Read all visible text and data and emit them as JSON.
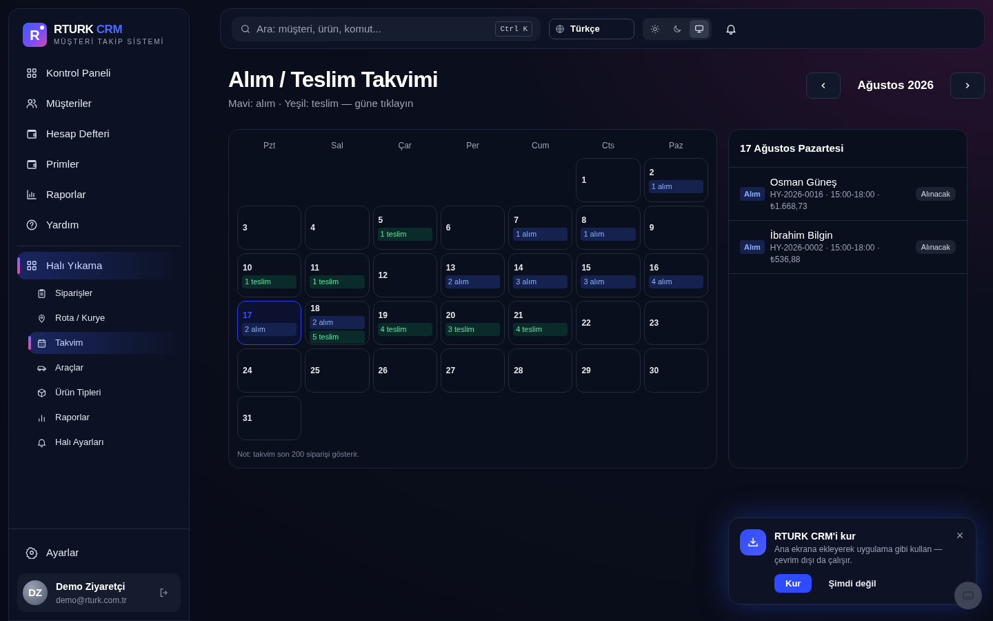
{
  "sidebar": {
    "brand": {
      "logo_letter": "R",
      "name": "RTURK",
      "name_accent": "CRM",
      "subtitle": "MÜŞTERİ TAKİP SİSTEMİ"
    },
    "items": [
      {
        "label": "Kontrol Paneli",
        "selected": false
      },
      {
        "label": "Müşteriler",
        "selected": false
      },
      {
        "label": "Hesap Defteri",
        "selected": false
      },
      {
        "label": "Primler",
        "selected": false
      },
      {
        "label": "Raporlar",
        "selected": false
      },
      {
        "label": "Yardım",
        "selected": false
      }
    ],
    "section": {
      "label": "Halı Yıkama",
      "selected": true,
      "children": [
        {
          "label": "Siparişler",
          "selected": false
        },
        {
          "label": "Rota / Kurye",
          "selected": false
        },
        {
          "label": "Takvim",
          "selected": true
        },
        {
          "label": "Araçlar",
          "selected": false
        },
        {
          "label": "Ürün Tipleri",
          "selected": false
        },
        {
          "label": "Raporlar",
          "selected": false
        },
        {
          "label": "Halı Ayarları",
          "selected": false
        }
      ]
    },
    "settings": {
      "label": "Ayarlar"
    },
    "user": {
      "initials": "DZ",
      "name": "Demo Ziyaretçi",
      "email": "demo@rturk.com.tr"
    }
  },
  "topbar": {
    "search": {
      "placeholder": "Ara: müşteri, ürün, komut...",
      "shortcut": "Ctrl K"
    },
    "language": "Türkçe",
    "themes": [
      {
        "selected": false
      },
      {
        "selected": false
      },
      {
        "selected": true
      }
    ]
  },
  "page": {
    "title": "Alım / Teslim Takvimi",
    "subtitle": "Mavi: alım · Yeşil: teslim — güne tıklayın",
    "month": "Ağustos 2026"
  },
  "calendar": {
    "weekdays": [
      "Pzt",
      "Sal",
      "Çar",
      "Per",
      "Cum",
      "Cts",
      "Paz"
    ],
    "cells": [
      {
        "kind": "blank"
      },
      {
        "kind": "blank"
      },
      {
        "kind": "blank"
      },
      {
        "kind": "blank"
      },
      {
        "kind": "blank"
      },
      {
        "kind": "day",
        "day": "1",
        "selected": false
      },
      {
        "kind": "day",
        "day": "2",
        "selected": false,
        "events": [
          {
            "kind": "pickup",
            "label": "1 alım"
          }
        ]
      },
      {
        "kind": "day",
        "day": "3",
        "selected": false
      },
      {
        "kind": "day",
        "day": "4",
        "selected": false
      },
      {
        "kind": "day",
        "day": "5",
        "selected": false,
        "events": [
          {
            "kind": "delivery",
            "label": "1 teslim"
          }
        ]
      },
      {
        "kind": "day",
        "day": "6",
        "selected": false
      },
      {
        "kind": "day",
        "day": "7",
        "selected": false,
        "events": [
          {
            "kind": "pickup",
            "label": "1 alım"
          }
        ]
      },
      {
        "kind": "day",
        "day": "8",
        "selected": false,
        "events": [
          {
            "kind": "pickup",
            "label": "1 alım"
          }
        ]
      },
      {
        "kind": "day",
        "day": "9",
        "selected": false
      },
      {
        "kind": "day",
        "day": "10",
        "selected": false,
        "events": [
          {
            "kind": "delivery",
            "label": "1 teslim"
          }
        ]
      },
      {
        "kind": "day",
        "day": "11",
        "selected": false,
        "events": [
          {
            "kind": "delivery",
            "label": "1 teslim"
          }
        ]
      },
      {
        "kind": "day",
        "day": "12",
        "selected": false
      },
      {
        "kind": "day",
        "day": "13",
        "selected": false,
        "events": [
          {
            "kind": "pickup",
            "label": "2 alım"
          }
        ]
      },
      {
        "kind": "day",
        "day": "14",
        "selected": false,
        "events": [
          {
            "kind": "pickup",
            "label": "3 alım"
          }
        ]
      },
      {
        "kind": "day",
        "day": "15",
        "selected": false,
        "events": [
          {
            "kind": "pickup",
            "label": "3 alım"
          }
        ]
      },
      {
        "kind": "day",
        "day": "16",
        "selected": false,
        "events": [
          {
            "kind": "pickup",
            "label": "4 alım"
          }
        ]
      },
      {
        "kind": "day",
        "day": "17",
        "selected": true,
        "events": [
          {
            "kind": "pickup",
            "label": "2 alım"
          }
        ]
      },
      {
        "kind": "day",
        "day": "18",
        "selected": false,
        "events": [
          {
            "kind": "pickup",
            "label": "2 alım"
          },
          {
            "kind": "delivery",
            "label": "5 teslim"
          }
        ]
      },
      {
        "kind": "day",
        "day": "19",
        "selected": false,
        "events": [
          {
            "kind": "delivery",
            "label": "4 teslim"
          }
        ]
      },
      {
        "kind": "day",
        "day": "20",
        "selected": false,
        "events": [
          {
            "kind": "delivery",
            "label": "3 teslim"
          }
        ]
      },
      {
        "kind": "day",
        "day": "21",
        "selected": false,
        "events": [
          {
            "kind": "delivery",
            "label": "4 teslim"
          }
        ]
      },
      {
        "kind": "day",
        "day": "22",
        "selected": false
      },
      {
        "kind": "day",
        "day": "23",
        "selected": false
      },
      {
        "kind": "day",
        "day": "24",
        "selected": false
      },
      {
        "kind": "day",
        "day": "25",
        "selected": false
      },
      {
        "kind": "day",
        "day": "26",
        "selected": false
      },
      {
        "kind": "day",
        "day": "27",
        "selected": false
      },
      {
        "kind": "day",
        "day": "28",
        "selected": false
      },
      {
        "kind": "day",
        "day": "29",
        "selected": false
      },
      {
        "kind": "day",
        "day": "30",
        "selected": false
      },
      {
        "kind": "day",
        "day": "31",
        "selected": false
      }
    ],
    "note": "Not: takvim son 200 siparişi gösterir."
  },
  "day_panel": {
    "title": "17 Ağustos Pazartesi",
    "entries": [
      {
        "type": "Alım",
        "name": "Osman Güneş",
        "detail": "HY-2026-0016 · 15:00-18:00 · ₺1.668,73",
        "status": "Alınacak"
      },
      {
        "type": "Alım",
        "name": "İbrahim Bilgin",
        "detail": "HY-2026-0002 · 15:00-18:00 · ₺536,88",
        "status": "Alınacak"
      }
    ]
  },
  "install_prompt": {
    "title": "RTURK CRM'i kur",
    "text": "Ana ekrana ekleyerek uygulama gibi kullan — çevrim dışı da çalışır.",
    "install": "Kur",
    "dismiss": "Şimdi değil",
    "close": "×"
  }
}
